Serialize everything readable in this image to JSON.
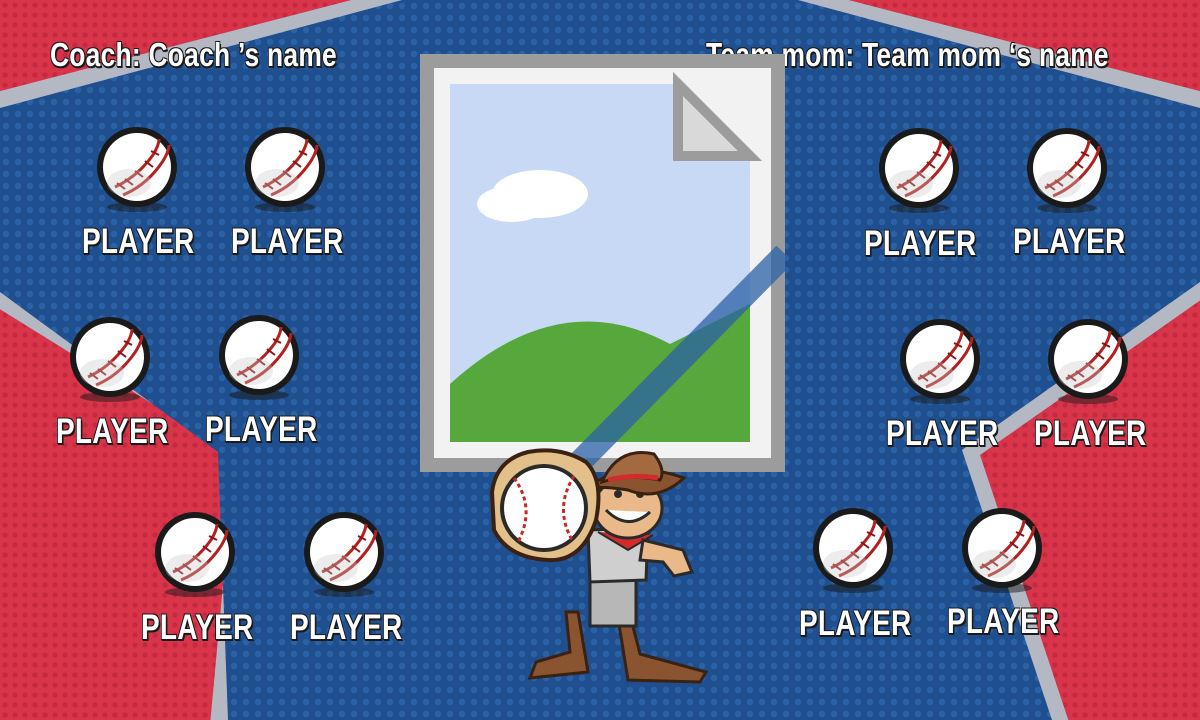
{
  "banner": {
    "coach_label": "Coach: Coach ’s name",
    "team_mom_label": "Team mom: Team mom ‘s name",
    "player_label": "PLAYER",
    "colors": {
      "star_blue": "#1f4f8f",
      "red_field": "#d8344a",
      "outline_gray": "#b3b8c2",
      "text": "#ffffff"
    }
  },
  "players": [
    {
      "label": "PLAYER"
    },
    {
      "label": "PLAYER"
    },
    {
      "label": "PLAYER"
    },
    {
      "label": "PLAYER"
    },
    {
      "label": "PLAYER"
    },
    {
      "label": "PLAYER"
    },
    {
      "label": "PLAYER"
    },
    {
      "label": "PLAYER"
    },
    {
      "label": "PLAYER"
    },
    {
      "label": "PLAYER"
    },
    {
      "label": "PLAYER"
    },
    {
      "label": "PLAYER"
    }
  ],
  "icons": {
    "ball": "baseball-icon",
    "photo": "image-placeholder-icon",
    "mascot": "cowboy-mascot-icon"
  }
}
